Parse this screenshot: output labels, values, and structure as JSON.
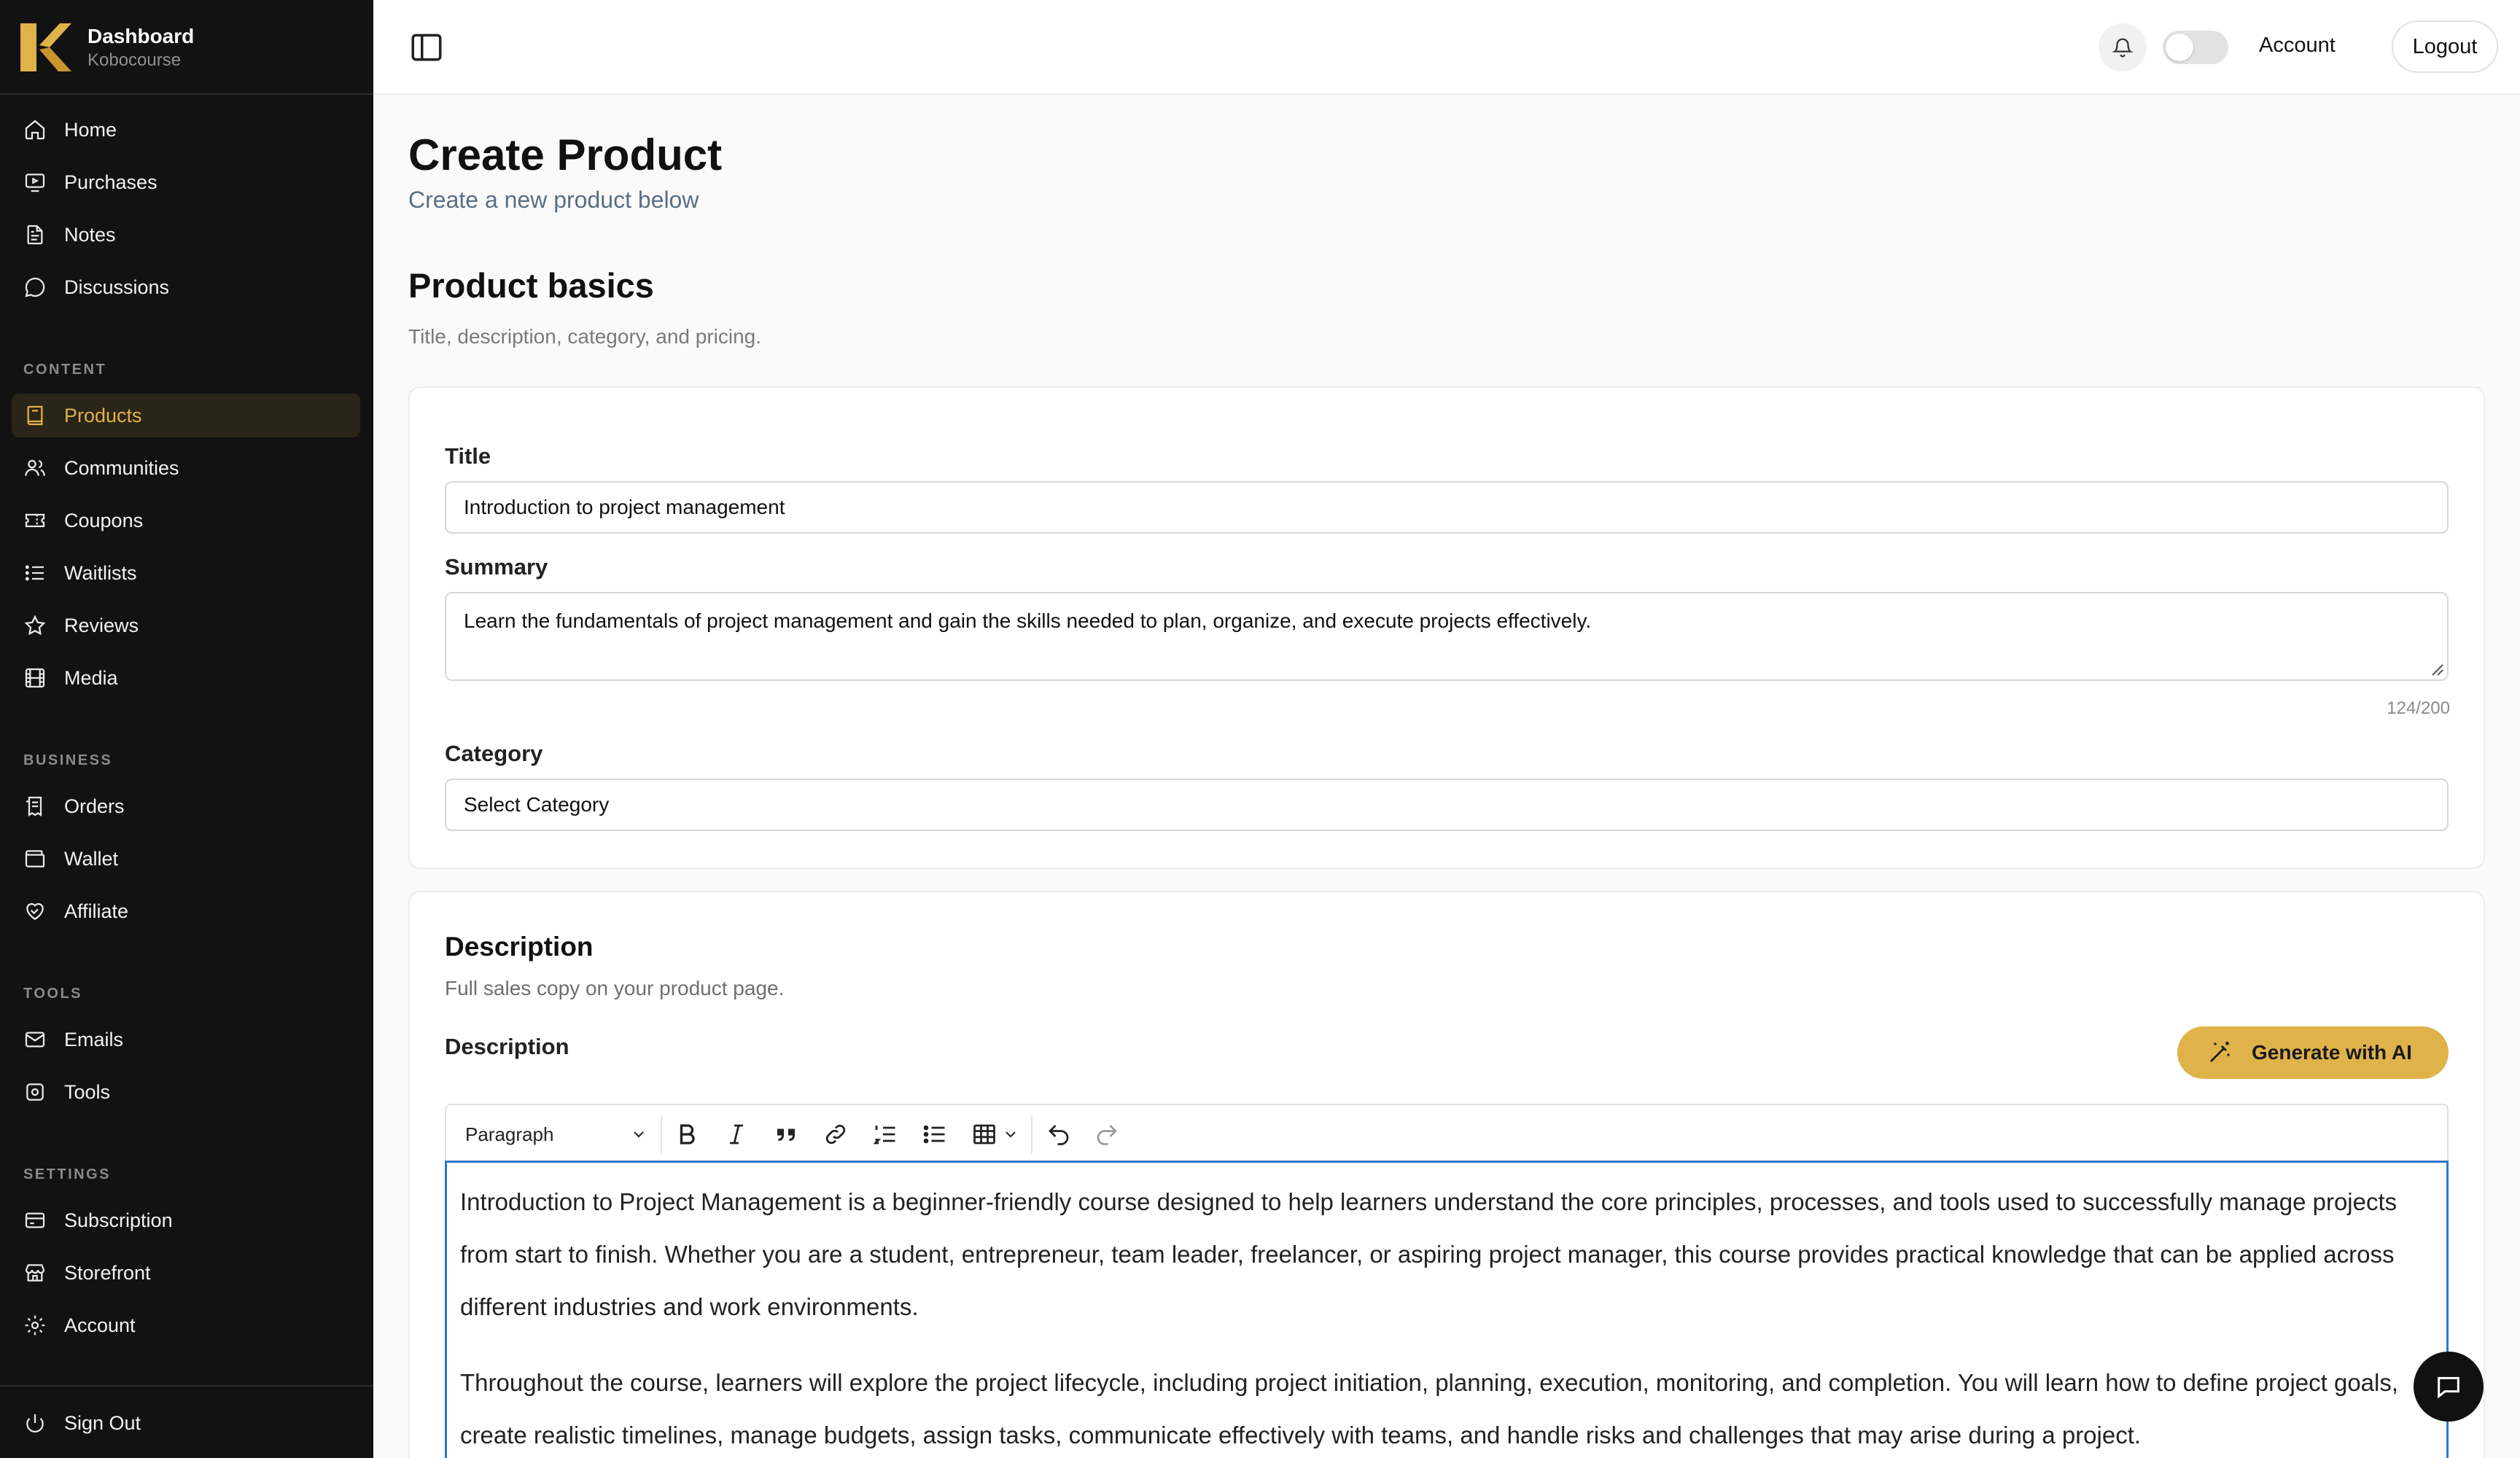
{
  "sidebar": {
    "brand": {
      "title": "Dashboard",
      "subtitle": "Kobocourse"
    },
    "items": [
      {
        "label": "Home"
      },
      {
        "label": "Purchases"
      },
      {
        "label": "Notes"
      },
      {
        "label": "Discussions"
      }
    ],
    "sections": [
      {
        "label": "CONTENT",
        "items": [
          {
            "label": "Products",
            "active": true
          },
          {
            "label": "Communities"
          },
          {
            "label": "Coupons"
          },
          {
            "label": "Waitlists"
          },
          {
            "label": "Reviews"
          },
          {
            "label": "Media"
          }
        ]
      },
      {
        "label": "BUSINESS",
        "items": [
          {
            "label": "Orders"
          },
          {
            "label": "Wallet"
          },
          {
            "label": "Affiliate"
          }
        ]
      },
      {
        "label": "TOOLS",
        "items": [
          {
            "label": "Emails"
          },
          {
            "label": "Tools"
          }
        ]
      },
      {
        "label": "SETTINGS",
        "items": [
          {
            "label": "Subscription"
          },
          {
            "label": "Storefront"
          },
          {
            "label": "Account"
          }
        ]
      }
    ],
    "sign_out": "Sign Out",
    "accent_color": "#e0b24a"
  },
  "topbar": {
    "account_label": "Account",
    "logout_label": "Logout"
  },
  "page": {
    "title": "Create Product",
    "subtitle": "Create a new product below"
  },
  "basics": {
    "title": "Product basics",
    "subtitle": "Title, description, category, and pricing.",
    "title_label": "Title",
    "title_value": "Introduction to project management",
    "summary_label": "Summary",
    "summary_value": "Learn the fundamentals of project management and gain the skills needed to plan, organize, and execute projects effectively.",
    "summary_counter": "124/200",
    "category_label": "Category",
    "category_value": "Select Category"
  },
  "description": {
    "title": "Description",
    "subtitle": "Full sales copy on your product page.",
    "field_label": "Description",
    "ai_button": "Generate with AI",
    "block_type": "Paragraph",
    "paragraphs": [
      "Introduction to Project Management is a beginner-friendly course designed to help learners understand the core principles, processes, and tools used to successfully manage projects from start to finish. Whether you are a student, entrepreneur, team leader, freelancer, or aspiring project manager, this course provides practical knowledge that can be applied across different industries and work environments.",
      "Throughout the course, learners will explore the project lifecycle, including project initiation, planning, execution, monitoring, and completion. You will learn how to define project goals, create realistic timelines, manage budgets, assign tasks, communicate effectively with teams, and handle risks and challenges that may arise during a project."
    ]
  }
}
